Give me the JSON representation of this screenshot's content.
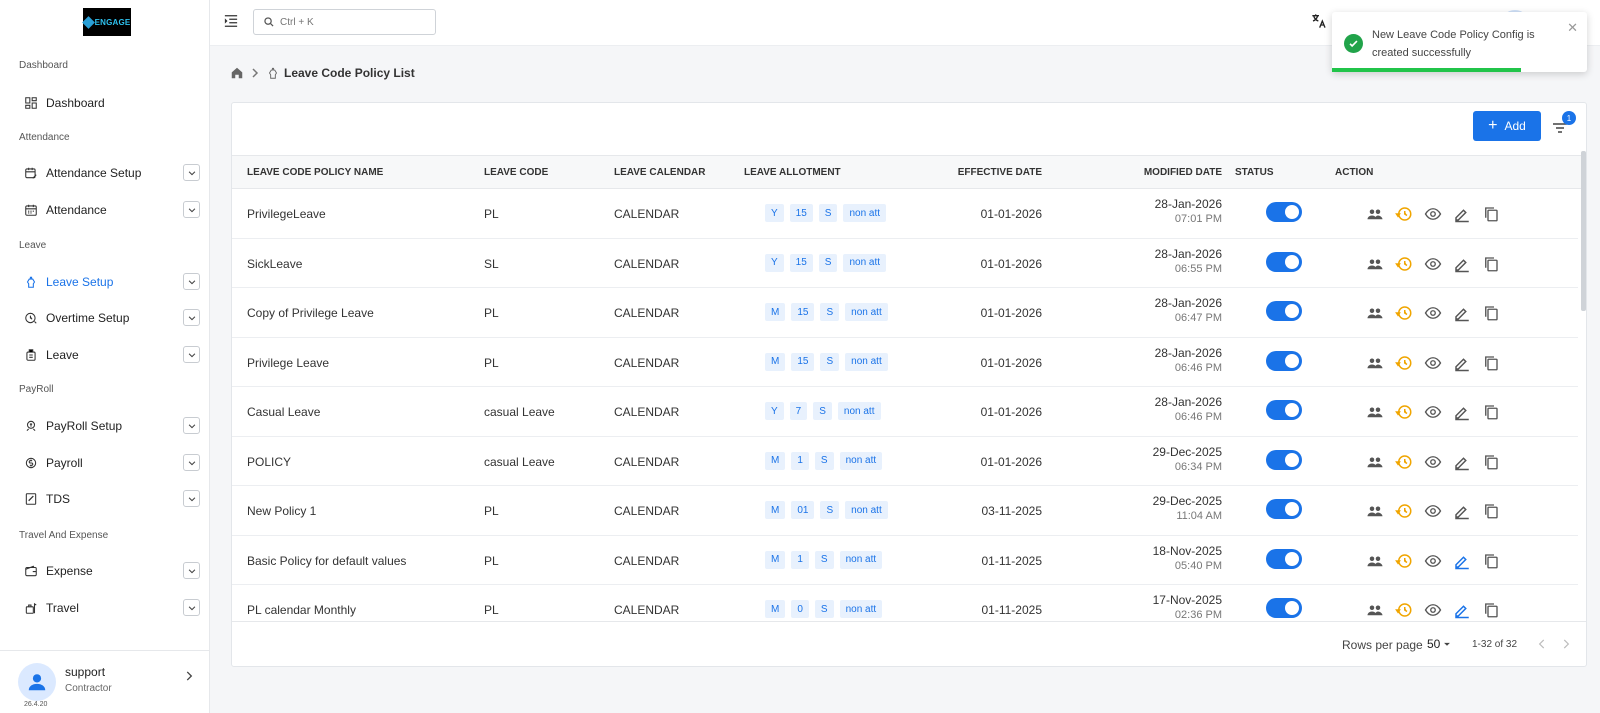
{
  "app": {
    "logo_text": "ENGAGE"
  },
  "search": {
    "placeholder": "Ctrl + K"
  },
  "toast": {
    "message": "New Leave Code Policy Config is created successfully",
    "close": "✕",
    "progress": 0.74
  },
  "breadcrumb": {
    "title": "Leave Code Policy List"
  },
  "sidebar": {
    "sections": [
      "Dashboard",
      "Attendance",
      "Leave",
      "PayRoll",
      "Travel And Expense"
    ],
    "items": [
      {
        "label": "Dashboard",
        "icon": "dashboard-icon",
        "expandable": false
      },
      {
        "label": "Attendance Setup",
        "icon": "calendar-edit-icon",
        "expandable": true
      },
      {
        "label": "Attendance",
        "icon": "calendar-icon",
        "expandable": true
      },
      {
        "label": "Leave Setup",
        "icon": "leave-setup-icon",
        "expandable": true,
        "active": true
      },
      {
        "label": "Overtime Setup",
        "icon": "clock-icon",
        "expandable": true
      },
      {
        "label": "Leave",
        "icon": "luggage-icon",
        "expandable": true
      },
      {
        "label": "PayRoll Setup",
        "icon": "payroll-setup-icon",
        "expandable": true
      },
      {
        "label": "Payroll",
        "icon": "money-icon",
        "expandable": true
      },
      {
        "label": "TDS",
        "icon": "tax-icon",
        "expandable": true
      },
      {
        "label": "Expense",
        "icon": "wallet-icon",
        "expandable": true
      },
      {
        "label": "Travel",
        "icon": "travel-icon",
        "expandable": true
      }
    ],
    "user": {
      "name": "support",
      "role": "Contractor",
      "version": "26.4.20"
    }
  },
  "toolbar": {
    "add_label": "Add",
    "filter_count": "1"
  },
  "table": {
    "columns": [
      "LEAVE CODE POLICY NAME",
      "LEAVE CODE",
      "LEAVE CALENDAR",
      "LEAVE ALLOTMENT",
      "EFFECTIVE DATE",
      "MODIFIED DATE",
      "STATUS",
      "ACTION"
    ],
    "rows": [
      {
        "name": "PrivilegeLeave",
        "code": "PL",
        "calendar": "CALENDAR",
        "allot": [
          "Y",
          "15",
          "S",
          "non att"
        ],
        "effective": "01-01-2026",
        "mod_date": "28-Jan-2026",
        "mod_time": "07:01 PM",
        "status": true,
        "edit_blue": false
      },
      {
        "name": "SickLeave",
        "code": "SL",
        "calendar": "CALENDAR",
        "allot": [
          "Y",
          "15",
          "S",
          "non att"
        ],
        "effective": "01-01-2026",
        "mod_date": "28-Jan-2026",
        "mod_time": "06:55 PM",
        "status": true,
        "edit_blue": false
      },
      {
        "name": "Copy of Privilege Leave",
        "code": "PL",
        "calendar": "CALENDAR",
        "allot": [
          "M",
          "15",
          "S",
          "non att"
        ],
        "effective": "01-01-2026",
        "mod_date": "28-Jan-2026",
        "mod_time": "06:47 PM",
        "status": true,
        "edit_blue": false
      },
      {
        "name": "Privilege Leave",
        "code": "PL",
        "calendar": "CALENDAR",
        "allot": [
          "M",
          "15",
          "S",
          "non att"
        ],
        "effective": "01-01-2026",
        "mod_date": "28-Jan-2026",
        "mod_time": "06:46 PM",
        "status": true,
        "edit_blue": false
      },
      {
        "name": "Casual Leave",
        "code": "casual Leave",
        "calendar": "CALENDAR",
        "allot": [
          "Y",
          "7",
          "S",
          "non att"
        ],
        "effective": "01-01-2026",
        "mod_date": "28-Jan-2026",
        "mod_time": "06:46 PM",
        "status": true,
        "edit_blue": false
      },
      {
        "name": "POLICY",
        "code": "casual Leave",
        "calendar": "CALENDAR",
        "allot": [
          "M",
          "1",
          "S",
          "non att"
        ],
        "effective": "01-01-2026",
        "mod_date": "29-Dec-2025",
        "mod_time": "06:34 PM",
        "status": true,
        "edit_blue": false
      },
      {
        "name": "New Policy 1",
        "code": "PL",
        "calendar": "CALENDAR",
        "allot": [
          "M",
          "01",
          "S",
          "non att"
        ],
        "effective": "03-11-2025",
        "mod_date": "29-Dec-2025",
        "mod_time": "11:04 AM",
        "status": true,
        "edit_blue": false
      },
      {
        "name": "Basic Policy for default values",
        "code": "PL",
        "calendar": "CALENDAR",
        "allot": [
          "M",
          "1",
          "S",
          "non att"
        ],
        "effective": "01-11-2025",
        "mod_date": "18-Nov-2025",
        "mod_time": "05:40 PM",
        "status": true,
        "edit_blue": true
      },
      {
        "name": "PL calendar Monthly",
        "code": "PL",
        "calendar": "CALENDAR",
        "allot": [
          "M",
          "0",
          "S",
          "non att"
        ],
        "effective": "01-11-2025",
        "mod_date": "17-Nov-2025",
        "mod_time": "02:36 PM",
        "status": true,
        "edit_blue": true
      }
    ]
  },
  "pagination": {
    "rows_per_page_label": "Rows per page",
    "rows_per_page": "50",
    "range": "1-32 of 32"
  },
  "colors": {
    "primary": "#1a73e8",
    "success": "#21a34a",
    "history": "#f0a500"
  }
}
